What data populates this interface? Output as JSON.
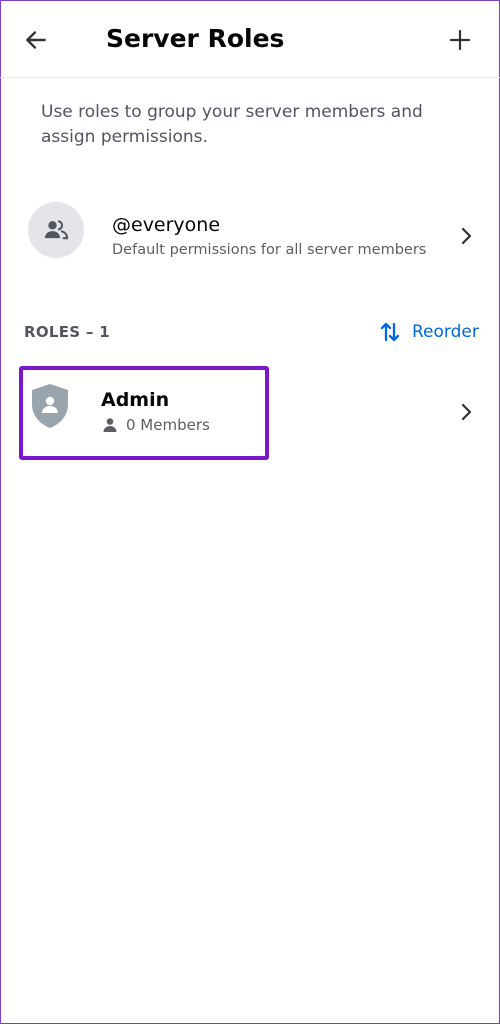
{
  "header": {
    "title": "Server Roles",
    "back_icon": "arrow-left-icon",
    "add_icon": "plus-icon"
  },
  "description": "Use roles to group your server members and assign permissions.",
  "everyone": {
    "name": "@everyone",
    "subtitle": "Default permissions for all server members",
    "icon": "members-icon"
  },
  "roles_section": {
    "header": "ROLES – 1",
    "reorder_label": "Reorder",
    "reorder_icon": "sort-arrows-icon"
  },
  "roles": [
    {
      "name": "Admin",
      "members": "0 Members",
      "icon": "shield-user-icon"
    }
  ],
  "colors": {
    "accent_link": "#0068e0",
    "highlight": "#7a17c9",
    "shield": "#9aa4ad",
    "text_muted": "#4f5660"
  }
}
